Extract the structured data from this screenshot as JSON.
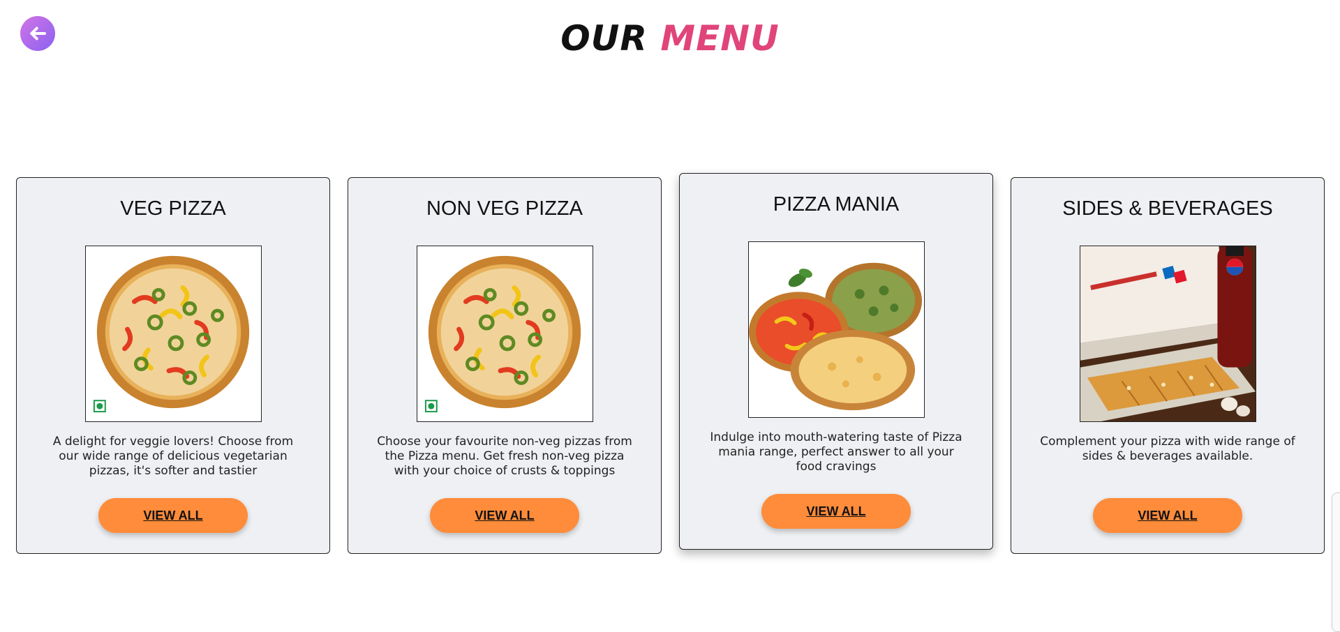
{
  "header": {
    "title_word1": "OUR",
    "title_word2": "MENU",
    "back_icon": "arrow-left-icon",
    "colors": {
      "accent": "#e0447a",
      "button": "#ff8c3a",
      "back_gradient": [
        "#d273e6",
        "#8a63f0"
      ]
    }
  },
  "cards": [
    {
      "title": "VEG PIZZA",
      "image": "veg-pizza-image",
      "description": "A delight for veggie lovers! Choose from our wide range of delicious vegetarian pizzas, it's softer and tastier",
      "button": "VIEW ALL"
    },
    {
      "title": "NON VEG PIZZA",
      "image": "non-veg-pizza-image",
      "description": "Choose your favourite non-veg pizzas from the Pizza menu. Get fresh non-veg pizza with your choice of crusts & toppings",
      "button": "VIEW ALL"
    },
    {
      "title": "PIZZA MANIA",
      "image": "pizza-mania-image",
      "description": "Indulge into mouth-watering taste of Pizza mania range, perfect answer to all your food cravings",
      "button": "VIEW ALL"
    },
    {
      "title": "SIDES & BEVERAGES",
      "image": "sides-beverages-image",
      "description": "Complement your pizza with wide range of sides & beverages available.",
      "button": "VIEW ALL"
    }
  ]
}
